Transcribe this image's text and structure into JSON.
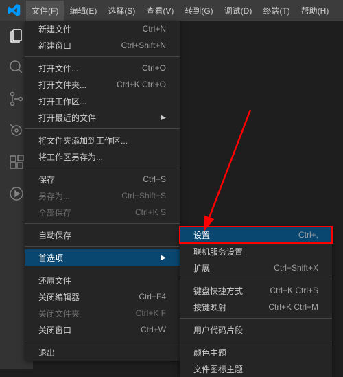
{
  "menubar": {
    "items": [
      {
        "label": "文件(F)"
      },
      {
        "label": "编辑(E)"
      },
      {
        "label": "选择(S)"
      },
      {
        "label": "查看(V)"
      },
      {
        "label": "转到(G)"
      },
      {
        "label": "调试(D)"
      },
      {
        "label": "终端(T)"
      },
      {
        "label": "帮助(H)"
      }
    ]
  },
  "activity": {
    "icons": [
      "explorer",
      "search",
      "source-control",
      "debug",
      "extensions",
      "test"
    ]
  },
  "fileMenu": {
    "groups": [
      [
        {
          "label": "新建文件",
          "shortcut": "Ctrl+N"
        },
        {
          "label": "新建窗口",
          "shortcut": "Ctrl+Shift+N"
        }
      ],
      [
        {
          "label": "打开文件...",
          "shortcut": "Ctrl+O"
        },
        {
          "label": "打开文件夹...",
          "shortcut": "Ctrl+K Ctrl+O"
        },
        {
          "label": "打开工作区..."
        },
        {
          "label": "打开最近的文件",
          "submenu": true
        }
      ],
      [
        {
          "label": "将文件夹添加到工作区..."
        },
        {
          "label": "将工作区另存为..."
        }
      ],
      [
        {
          "label": "保存",
          "shortcut": "Ctrl+S"
        },
        {
          "label": "另存为...",
          "shortcut": "Ctrl+Shift+S",
          "disabled": true
        },
        {
          "label": "全部保存",
          "shortcut": "Ctrl+K S",
          "disabled": true
        }
      ],
      [
        {
          "label": "自动保存"
        }
      ],
      [
        {
          "label": "首选项",
          "submenu": true,
          "highlighted": true
        }
      ],
      [
        {
          "label": "还原文件"
        },
        {
          "label": "关闭编辑器",
          "shortcut": "Ctrl+F4"
        },
        {
          "label": "关闭文件夹",
          "shortcut": "Ctrl+K F",
          "disabled": true
        },
        {
          "label": "关闭窗口",
          "shortcut": "Ctrl+W"
        }
      ],
      [
        {
          "label": "退出"
        }
      ]
    ]
  },
  "preferencesSubmenu": {
    "groups": [
      [
        {
          "label": "设置",
          "shortcut": "Ctrl+,",
          "highlighted": true
        },
        {
          "label": "联机服务设置"
        },
        {
          "label": "扩展",
          "shortcut": "Ctrl+Shift+X"
        }
      ],
      [
        {
          "label": "键盘快捷方式",
          "shortcut": "Ctrl+K Ctrl+S"
        },
        {
          "label": "按键映射",
          "shortcut": "Ctrl+K Ctrl+M"
        }
      ],
      [
        {
          "label": "用户代码片段"
        }
      ],
      [
        {
          "label": "颜色主题"
        },
        {
          "label": "文件图标主题"
        }
      ]
    ]
  }
}
